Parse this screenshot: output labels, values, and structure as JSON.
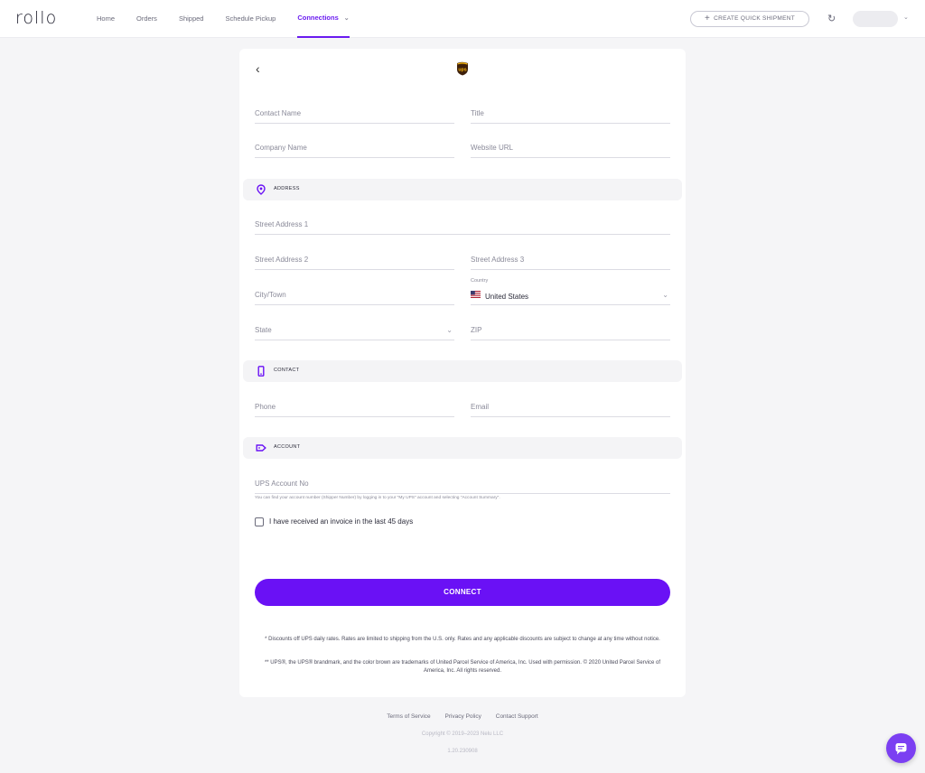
{
  "app": {
    "logo": "rollo"
  },
  "nav": {
    "items": [
      {
        "label": "Home"
      },
      {
        "label": "Orders"
      },
      {
        "label": "Shipped"
      },
      {
        "label": "Schedule Pickup"
      },
      {
        "label": "Connections"
      }
    ],
    "active": "Connections",
    "quick_shipment": "CREATE QUICK SHIPMENT"
  },
  "form": {
    "contact_name": "Contact Name",
    "title": "Title",
    "company_name": "Company Name",
    "website_url": "Website URL",
    "sections": {
      "address": "ADDRESS",
      "contact": "CONTACT",
      "account": "ACCOUNT"
    },
    "street1": "Street Address 1",
    "street2": "Street Address 2",
    "street3": "Street Address 3",
    "city": "City/Town",
    "country_label": "Country",
    "country_value": "United States",
    "state": "State",
    "zip": "ZIP",
    "phone": "Phone",
    "email": "Email",
    "ups_account": "UPS Account No",
    "hint": "You can find your account number (Shipper Number) by logging in to your \"My UPS\" account and selecting \"Account Summary\".",
    "invoice_checkbox": "I have received an invoice in the last 45 days",
    "connect_button": "CONNECT"
  },
  "disclaimers": {
    "line1": "* Discounts off UPS daily rates. Rates are limited to shipping from the U.S. only. Rates and any applicable discounts are subject to change at any time without notice.",
    "line2": "** UPS®, the UPS® brandmark, and the color brown are trademarks of United Parcel Service of America, Inc. Used with permission. © 2020 United Parcel Service of America, Inc. All rights reserved."
  },
  "footer": {
    "terms": "Terms of Service",
    "privacy": "Privacy Policy",
    "support": "Contact Support",
    "copyright": "Copyright © 2019–2023 Nelu LLC",
    "version": "1.20.230908"
  },
  "colors": {
    "accent": "#6a11f5",
    "ups_brown": "#3d1f0a",
    "ups_gold": "#f5b50a"
  },
  "icons": [
    "back-arrow-icon",
    "ups-logo-icon",
    "refresh-icon",
    "location-pin-icon",
    "phone-device-icon",
    "tag-icon",
    "chat-icon",
    "chevron-down-icon",
    "plus-icon",
    "us-flag-icon"
  ]
}
